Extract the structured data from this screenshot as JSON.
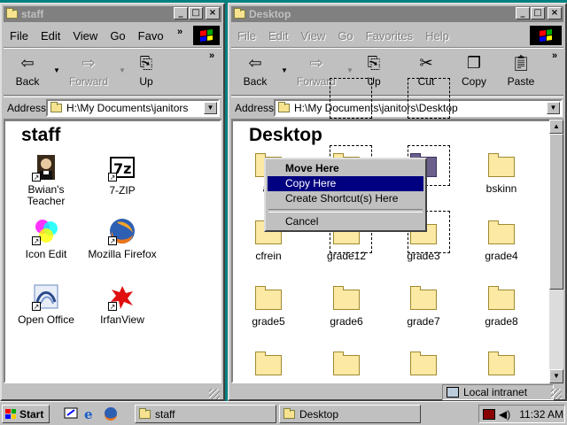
{
  "left_window": {
    "title": "staff",
    "menu": [
      "File",
      "Edit",
      "View",
      "Go",
      "Favo"
    ],
    "toolbar": {
      "back": "Back",
      "forward": "Forward",
      "up": "Up"
    },
    "address_label": "Address",
    "address_value": "H:\\My Documents\\janitors",
    "content_title": "staff",
    "icons": [
      {
        "label": "Bwian's\nTeacher",
        "icon": "teacher-portrait-icon"
      },
      {
        "label": "7-ZIP",
        "icon": "7zip-icon"
      },
      {
        "label": "Icon Edit",
        "icon": "icon-edit-icon"
      },
      {
        "label": "Mozilla Firefox",
        "icon": "firefox-icon"
      },
      {
        "label": "Open Office",
        "icon": "openoffice-icon"
      },
      {
        "label": "IrfanView",
        "icon": "irfanview-icon"
      }
    ]
  },
  "right_window": {
    "title": "Desktop",
    "menu": [
      "File",
      "Edit",
      "View",
      "Go",
      "Favorites",
      "Help"
    ],
    "toolbar": {
      "back": "Back",
      "forward": "Forward",
      "up": "Up",
      "cut": "Cut",
      "copy": "Copy",
      "paste": "Paste"
    },
    "address_label": "Address",
    "address_value": "H:\\My Documents\\janitors\\Desktop",
    "content_title": "Desktop",
    "folders_row1": [
      "ac",
      "",
      "",
      "bskinn"
    ],
    "folders_row2": [
      "cfrein",
      "grade12",
      "grade3",
      "grade4"
    ],
    "folders_row3": [
      "grade5",
      "grade6",
      "grade7",
      "grade8"
    ],
    "status_zone": "Local intranet"
  },
  "context_menu": {
    "items": [
      "Move Here",
      "Copy Here",
      "Create Shortcut(s) Here",
      "Cancel"
    ],
    "highlighted": "Copy Here"
  },
  "taskbar": {
    "start_label": "Start",
    "tasks": [
      "staff",
      "Desktop"
    ],
    "clock": "11:32 AM"
  },
  "colors": {
    "title_inactive": "#808080",
    "highlight": "#000080",
    "face": "#c0c0c0"
  }
}
